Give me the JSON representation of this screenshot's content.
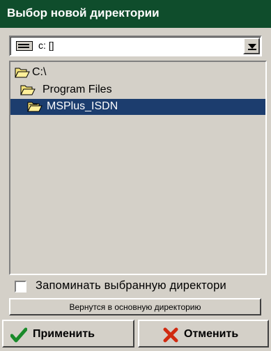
{
  "window": {
    "title": "Выбор новой директории"
  },
  "drive_combo": {
    "value": "c: []",
    "icon": "drive-icon",
    "arrow_icon": "chevron-down-icon"
  },
  "tree": {
    "items": [
      {
        "label": "C:\\",
        "icon": "folder-open-icon",
        "selected": false
      },
      {
        "label": "Program Files",
        "icon": "folder-open-icon",
        "selected": false
      },
      {
        "label": "MSPlus_ISDN",
        "icon": "folder-open-icon",
        "selected": true
      }
    ]
  },
  "remember_option": {
    "label": "Запоминать выбранную директори",
    "checked": false
  },
  "buttons": {
    "home_label": "Вернутся в основную директорию",
    "apply_label": "Применить",
    "cancel_label": "Отменить"
  },
  "colors": {
    "titlebar": "#0f4d2c",
    "selection": "#1c3d6e",
    "face": "#d4d0c8",
    "apply_check": "#1a8a2a",
    "cancel_x": "#d02a10"
  }
}
